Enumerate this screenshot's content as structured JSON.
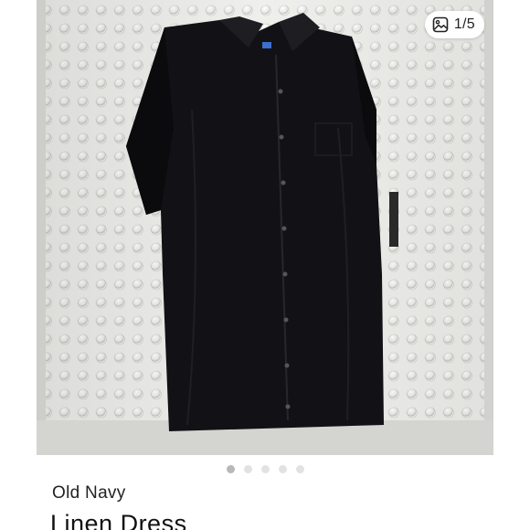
{
  "listing": {
    "image_counter": "1/5",
    "image_count_total": 5,
    "active_image_index": 1,
    "brand": "Old Navy",
    "title": "Linen Dress"
  },
  "icons": {
    "counter_icon": "image-gallery-icon"
  },
  "colors": {
    "background": "#ffffff",
    "dot_inactive": "#e2e2e2",
    "dot_active": "#b8b8b8",
    "garment": "#111114"
  }
}
